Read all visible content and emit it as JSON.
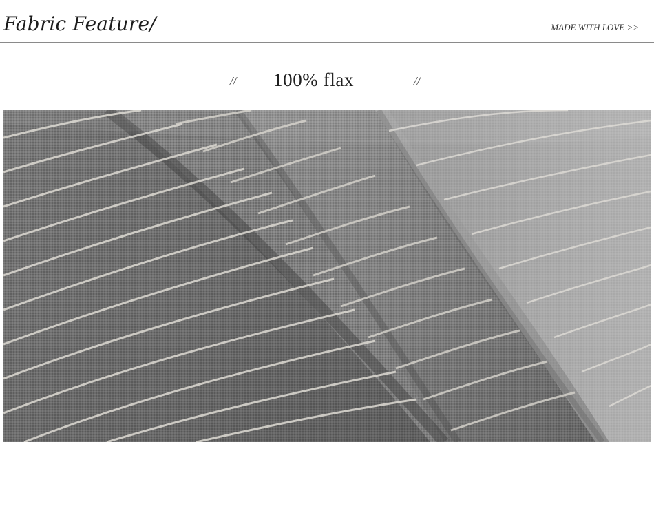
{
  "header": {
    "title": "Fabric Feature/",
    "tagline": "MADE WITH LOVE >>"
  },
  "section": {
    "left_mark": "//",
    "heading": "100% flax",
    "right_mark": "//"
  },
  "photo": {
    "subject": "fabric-photo",
    "colors": {
      "base": "#7d7d7d",
      "dark": "#5e5e5e",
      "light": "#b4b4b4",
      "stripe": "#d6d3cc"
    }
  }
}
